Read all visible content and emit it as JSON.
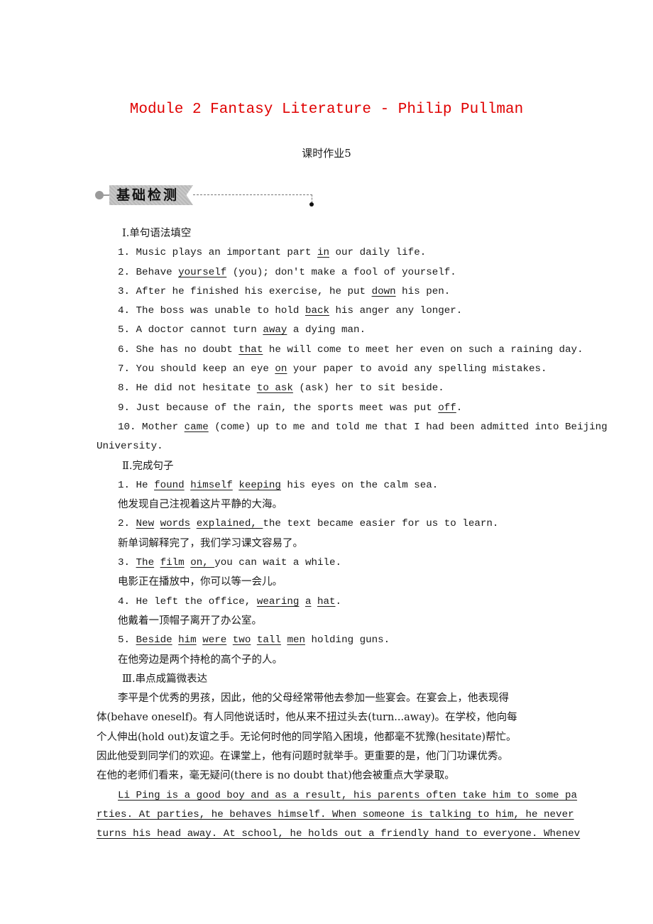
{
  "title": "Module 2 Fantasy Literature  -  Philip Pullman",
  "subtitle": "课时作业5",
  "section_badge": "基础检测",
  "part1": {
    "heading": "Ⅰ.单句语法填空",
    "items": [
      {
        "pre": "1. Music plays an important part ",
        "answer": "in",
        "post": " our daily life."
      },
      {
        "pre": "2. Behave ",
        "answer": "yourself",
        "post": " (you); don't make a fool of yourself."
      },
      {
        "pre": "3. After he finished his exercise, he put ",
        "answer": "down",
        "post": " his pen."
      },
      {
        "pre": "4. The boss was unable to hold ",
        "answer": "back",
        "post": " his anger any longer."
      },
      {
        "pre": "5. A doctor cannot turn ",
        "answer": "away",
        "post": " a dying man."
      },
      {
        "pre": "6. She has no doubt ",
        "answer": "that",
        "post": " he will come to meet her even on such a raining day."
      },
      {
        "pre": "7. You should keep an eye ",
        "answer": "on",
        "post": " your paper to avoid any spelling mistakes."
      },
      {
        "pre": "8. He did not hesitate ",
        "answer": "to ask",
        "post": " (ask) her to sit beside."
      },
      {
        "pre": "9. Just because of the rain, the sports meet was put ",
        "answer": "off",
        "post": "."
      },
      {
        "pre": "10. Mother ",
        "answer": "came",
        "post": " (come) up to me and told me that I had been admitted into Beijing",
        "cont": "University."
      }
    ]
  },
  "part2": {
    "heading": "Ⅱ.完成句子",
    "items": [
      {
        "num": "1. He ",
        "answers": [
          "found",
          "himself",
          "keeping"
        ],
        "post": " his eyes on the calm sea.",
        "zh": "他发现自己注视着这片平静的大海。"
      },
      {
        "num": "2. ",
        "answers": [
          "New",
          "words",
          "explained, "
        ],
        "post": "the text became easier for us to learn.",
        "zh": "新单词解释完了，我们学习课文容易了。"
      },
      {
        "num": "3. ",
        "answers": [
          "The",
          "film",
          "on, "
        ],
        "post": "you can wait a while.",
        "zh": "电影正在播放中，你可以等一会儿。"
      },
      {
        "num": "4. He left the office, ",
        "answers": [
          "wearing",
          "a",
          "hat"
        ],
        "post": ".",
        "zh": "他戴着一顶帽子离开了办公室。"
      },
      {
        "num": "5. ",
        "answers": [
          "Beside",
          "him",
          "were",
          "two",
          "tall",
          "men"
        ],
        "post": " holding guns.",
        "zh": "在他旁边是两个持枪的高个子的人。"
      }
    ]
  },
  "part3": {
    "heading": "Ⅲ.串点成篇微表达",
    "zh_lines": [
      "李平是个优秀的男孩，因此，他的父母经常带他去参加一些宴会。在宴会上，他表现得",
      "体(behave oneself)。有人同他说话时，他从来不扭过头去(turn...away)。在学校，他向每",
      "个人伸出(hold out)友谊之手。无论何时他的同学陷入困境，他都毫不犹豫(hesitate)帮忙。",
      "因此他受到同学们的欢迎。在课堂上，他有问题时就举手。更重要的是，他门门功课优秀。",
      "在他的老师们看来，毫无疑问(there is no doubt that)他会被重点大学录取。"
    ],
    "en_lines": [
      "Li Ping is a good boy and as a result, his parents often take him to some pa",
      "rties. At parties, he behaves himself. When someone is talking to him, he never ",
      "turns his head away. At school, he holds out a friendly hand to everyone. Whenev"
    ]
  }
}
